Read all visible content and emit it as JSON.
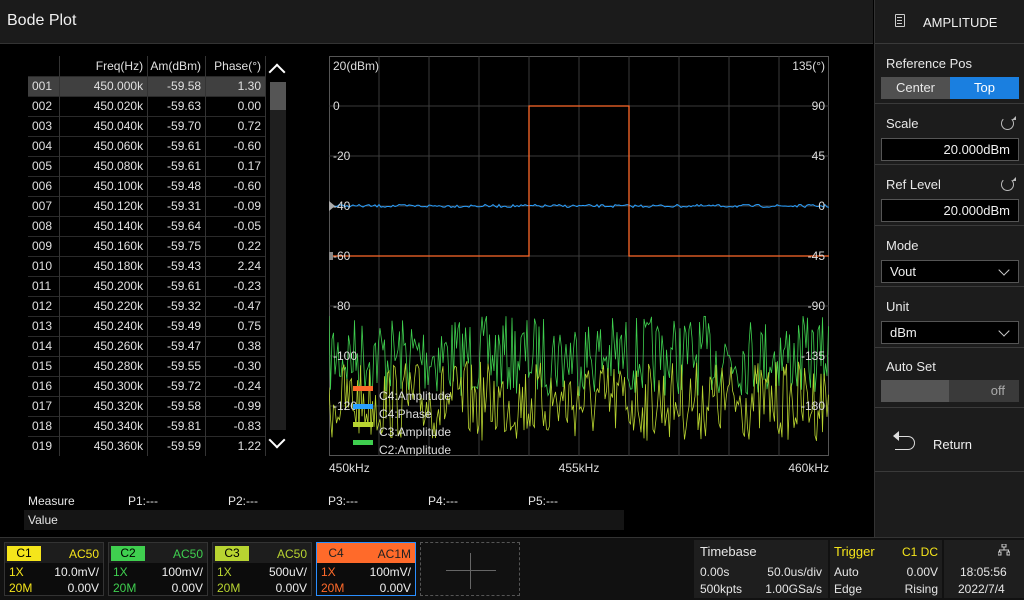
{
  "header": {
    "title": "Bode Plot"
  },
  "panel": {
    "title": "AMPLITUDE",
    "reference_pos": {
      "label": "Reference Pos",
      "options": [
        "Center",
        "Top"
      ],
      "selected": "Top"
    },
    "scale": {
      "label": "Scale",
      "value": "20.000dBm"
    },
    "ref_level": {
      "label": "Ref Level",
      "value": "20.000dBm"
    },
    "mode": {
      "label": "Mode",
      "value": "Vout"
    },
    "unit": {
      "label": "Unit",
      "value": "dBm"
    },
    "auto_set": {
      "label": "Auto Set",
      "value": "off"
    },
    "return_label": "Return"
  },
  "table": {
    "headers": [
      "",
      "Freq(Hz)",
      "Am(dBm)",
      "Phase(°)"
    ],
    "rows": [
      [
        "001",
        "450.000k",
        "-59.58",
        "1.30"
      ],
      [
        "002",
        "450.020k",
        "-59.63",
        "0.00"
      ],
      [
        "003",
        "450.040k",
        "-59.70",
        "0.72"
      ],
      [
        "004",
        "450.060k",
        "-59.61",
        "-0.60"
      ],
      [
        "005",
        "450.080k",
        "-59.61",
        "0.17"
      ],
      [
        "006",
        "450.100k",
        "-59.48",
        "-0.60"
      ],
      [
        "007",
        "450.120k",
        "-59.31",
        "-0.09"
      ],
      [
        "008",
        "450.140k",
        "-59.64",
        "-0.05"
      ],
      [
        "009",
        "450.160k",
        "-59.75",
        "0.22"
      ],
      [
        "010",
        "450.180k",
        "-59.43",
        "2.24"
      ],
      [
        "011",
        "450.200k",
        "-59.61",
        "-0.23"
      ],
      [
        "012",
        "450.220k",
        "-59.32",
        "-0.47"
      ],
      [
        "013",
        "450.240k",
        "-59.49",
        "0.75"
      ],
      [
        "014",
        "450.260k",
        "-59.47",
        "0.38"
      ],
      [
        "015",
        "450.280k",
        "-59.55",
        "-0.30"
      ],
      [
        "016",
        "450.300k",
        "-59.72",
        "-0.24"
      ],
      [
        "017",
        "450.320k",
        "-59.58",
        "-0.99"
      ],
      [
        "018",
        "450.340k",
        "-59.81",
        "-0.83"
      ],
      [
        "019",
        "450.360k",
        "-59.59",
        "1.22"
      ]
    ]
  },
  "chart_data": {
    "type": "line",
    "left_axis_unit": "20(dBm)",
    "right_axis_unit": "135(°)",
    "left_ticks": [
      "0",
      "-20",
      "-40",
      "-60",
      "-80",
      "-100",
      "-120"
    ],
    "right_ticks": [
      "90",
      "45",
      "0",
      "-45",
      "-90",
      "-135",
      "-180"
    ],
    "x_ticks": [
      "450kHz",
      "455kHz",
      "460kHz"
    ],
    "xlim": [
      450,
      460
    ],
    "ylim_left": [
      -140,
      20
    ],
    "ylim_right": [
      -225,
      135
    ],
    "grid": true,
    "legend_position": "bottom-left",
    "series": [
      {
        "name": "C4:Amplitude",
        "color": "#ff6a2a",
        "axis": "left",
        "points": [
          [
            450,
            -60
          ],
          [
            454,
            -60
          ],
          [
            454,
            0
          ],
          [
            456,
            0
          ],
          [
            456,
            -60
          ],
          [
            460,
            -60
          ]
        ]
      },
      {
        "name": "C4:Phase",
        "color": "#2aa0ff",
        "axis": "right",
        "points": [
          [
            450,
            0
          ],
          [
            460,
            0
          ]
        ]
      },
      {
        "name": "C3:Amplitude",
        "color": "#b8d431",
        "axis": "left",
        "level": -118
      },
      {
        "name": "C2:Amplitude",
        "color": "#3fcf4f",
        "axis": "left",
        "level": -100
      }
    ]
  },
  "measure": {
    "label": "Measure",
    "p_labels": [
      "P1:---",
      "P2:---",
      "P3:---",
      "P4:---",
      "P5:---"
    ],
    "value_label": "Value"
  },
  "channels": [
    {
      "name": "C1",
      "coupling": "AC50",
      "probe": "1X",
      "scale": "10.0mV/",
      "bw": "20M",
      "offset": "0.00V",
      "color": "#f5e51b"
    },
    {
      "name": "C2",
      "coupling": "AC50",
      "probe": "1X",
      "scale": "100mV/",
      "bw": "20M",
      "offset": "0.00V",
      "color": "#3fcf4f"
    },
    {
      "name": "C3",
      "coupling": "AC50",
      "probe": "1X",
      "scale": "500uV/",
      "bw": "20M",
      "offset": "0.00V",
      "color": "#b8d431"
    },
    {
      "name": "C4",
      "coupling": "AC1M",
      "probe": "1X",
      "scale": "100mV/",
      "bw": "20M",
      "offset": "0.00V",
      "color": "#ff6a2a"
    }
  ],
  "timebase": {
    "label": "Timebase",
    "delay": "0.00s",
    "scale": "50.0us/div",
    "points": "500kpts",
    "rate": "1.00GSa/s"
  },
  "trigger": {
    "label": "Trigger",
    "source": "C1 DC",
    "mode": "Auto",
    "level": "0.00V",
    "type": "Edge",
    "slope": "Rising"
  },
  "clock": {
    "time": "18:05:56",
    "date": "2022/7/4"
  },
  "colors": {
    "accent": "#1a7fe0"
  }
}
